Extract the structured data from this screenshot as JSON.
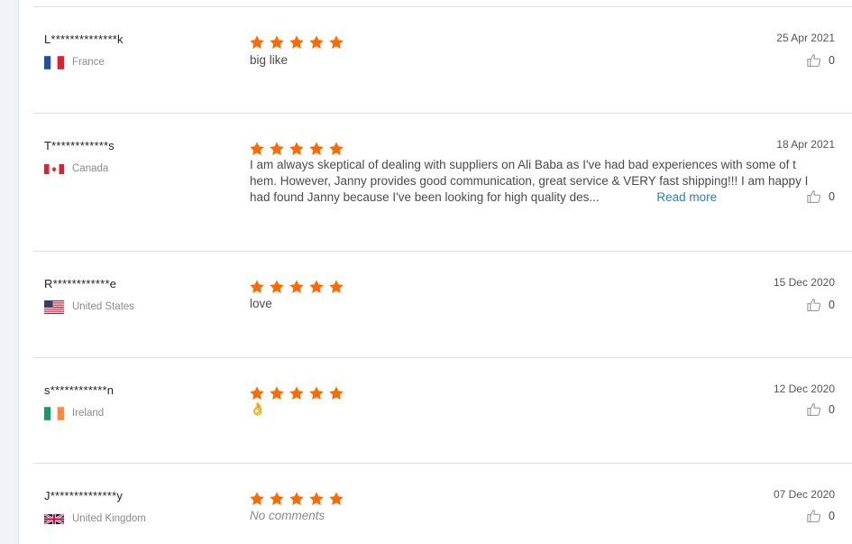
{
  "reviews": [
    {
      "reviewer": "L**************k",
      "country": "France",
      "flag": "fr",
      "rating": 5,
      "text": "big like",
      "read_more": "",
      "date": "25 Apr 2021",
      "helpful_count": "0"
    },
    {
      "reviewer": "T************s",
      "country": "Canada",
      "flag": "ca",
      "rating": 5,
      "text": "I am always skeptical of dealing with suppliers on Ali Baba as I've had bad experiences with some of t hem. However, Janny provides good communication, great service & VERY fast shipping!!! I am happy I had found Janny because I've been looking for high quality des...",
      "read_more": "Read more",
      "date": "18 Apr 2021",
      "helpful_count": "0"
    },
    {
      "reviewer": "R************e",
      "country": "United States",
      "flag": "us",
      "rating": 5,
      "text": "love",
      "read_more": "",
      "date": "15 Dec 2020",
      "helpful_count": "0"
    },
    {
      "reviewer": "s************n",
      "country": "Ireland",
      "flag": "ie",
      "rating": 5,
      "text": "👌",
      "read_more": "",
      "date": "12 Dec 2020",
      "helpful_count": "0"
    },
    {
      "reviewer": "J**************y",
      "country": "United Kingdom",
      "flag": "gb",
      "rating": 5,
      "text": "No comments",
      "read_more": "",
      "date": "07 Dec 2020",
      "helpful_count": "0"
    }
  ],
  "colors": {
    "star": "#ff6a00",
    "link": "#2a7ec2",
    "divider": "#e0e0e0"
  },
  "icons": {
    "star": "star-icon",
    "thumb": "thumbs-up-icon"
  }
}
